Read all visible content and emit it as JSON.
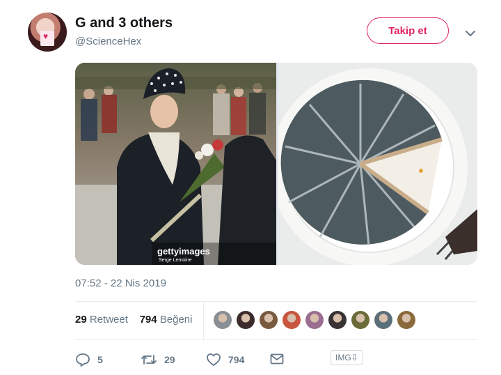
{
  "tweet": {
    "author": {
      "display_name": "G and 3 others",
      "handle": "@ScienceHex"
    },
    "follow_button": "Takip et",
    "media": {
      "watermark_logo": "gettyimages",
      "photographer_credit": "Serge Lemoine"
    },
    "timestamp": "07:52 - 22 Nis 2019",
    "stats": {
      "retweet_count": "29",
      "retweet_label": "Retweet",
      "like_count": "794",
      "like_label": "Beğeni"
    },
    "actions": {
      "reply_count": "5",
      "retweet_count": "29",
      "like_count": "794",
      "img_badge": "IMG⇩"
    }
  },
  "colors": {
    "accent": "#e0245e",
    "muted": "#657786",
    "text": "#14171a",
    "divider": "#e6ecf0"
  },
  "likers": [
    {
      "icon": "avatar-liker-1",
      "color": "#8a8f95"
    },
    {
      "icon": "avatar-liker-2",
      "color": "#3b2b2b"
    },
    {
      "icon": "avatar-liker-3",
      "color": "#7a5a3f"
    },
    {
      "icon": "avatar-liker-4",
      "color": "#c8553d"
    },
    {
      "icon": "avatar-liker-5",
      "color": "#9b6d8f"
    },
    {
      "icon": "avatar-liker-6",
      "color": "#3a3336"
    },
    {
      "icon": "avatar-liker-7",
      "color": "#6b6b3a"
    },
    {
      "icon": "avatar-liker-8",
      "color": "#5b6f7a"
    },
    {
      "icon": "avatar-liker-9",
      "color": "#8a6a3a"
    }
  ]
}
